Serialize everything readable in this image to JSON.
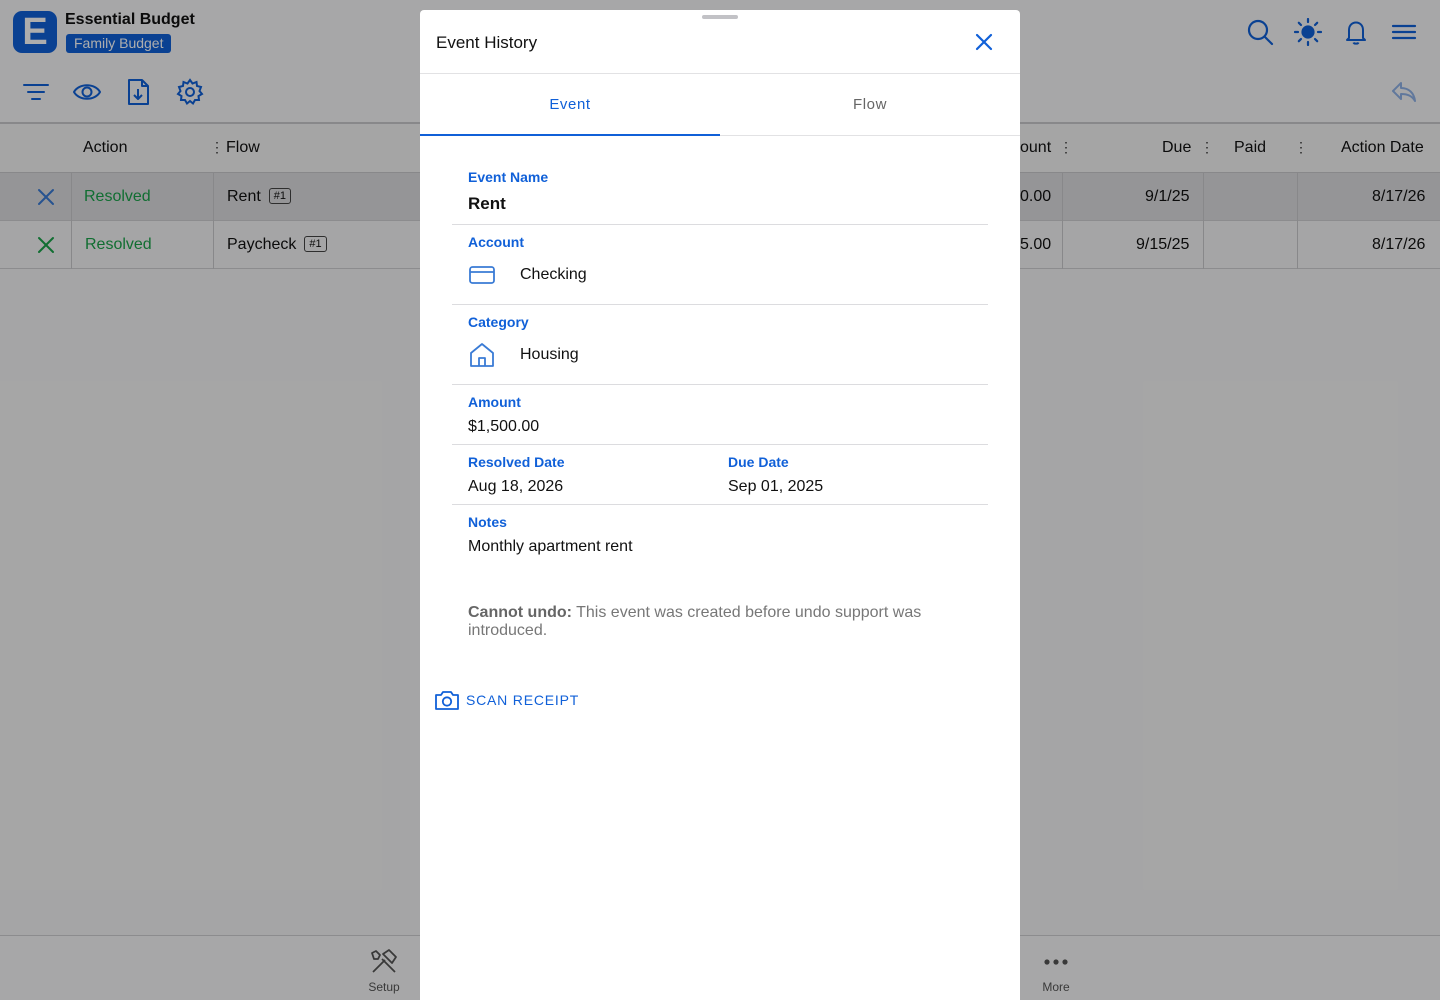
{
  "app": {
    "logo_letter": "E",
    "title": "Essential Budget",
    "budget_name": "Family Budget"
  },
  "toolbar": {
    "icons": [
      "filter-icon",
      "eye-icon",
      "download-icon",
      "settings-icon",
      "search-icon",
      "brightness-icon",
      "bell-icon",
      "menu-icon",
      "undo-icon"
    ]
  },
  "table": {
    "columns": {
      "action": "Action",
      "flow": "Flow",
      "amount": "ount",
      "due": "Due",
      "paid": "Paid",
      "action_date": "Action Date"
    },
    "rows": [
      {
        "action": "Resolved",
        "flow": "Rent",
        "flow_badge": "#1",
        "amount": "0.00",
        "due": "9/1/25",
        "paid": "",
        "action_date": "8/17/26"
      },
      {
        "action": "Resolved",
        "flow": "Paycheck",
        "flow_badge": "#1",
        "amount": "5.00",
        "due": "9/15/25",
        "paid": "",
        "action_date": "8/17/26"
      }
    ]
  },
  "bottom_nav": {
    "setup": "Setup",
    "more": "More"
  },
  "modal": {
    "title": "Event History",
    "tabs": {
      "event": "Event",
      "flow": "Flow"
    },
    "event_name_label": "Event Name",
    "event_name": "Rent",
    "account_label": "Account",
    "account": "Checking",
    "category_label": "Category",
    "category": "Housing",
    "amount_label": "Amount",
    "amount": "$1,500.00",
    "resolved_date_label": "Resolved Date",
    "resolved_date": "Aug 18, 2026",
    "due_date_label": "Due Date",
    "due_date": "Sep 01, 2025",
    "notes_label": "Notes",
    "notes": "Monthly apartment rent",
    "undo_notice_bold": "Cannot undo:",
    "undo_notice_text": " This event was created before undo support was introduced.",
    "scan_receipt": "SCAN RECEIPT"
  },
  "colors": {
    "accent": "#1060d8",
    "resolved": "#1aa34a"
  }
}
